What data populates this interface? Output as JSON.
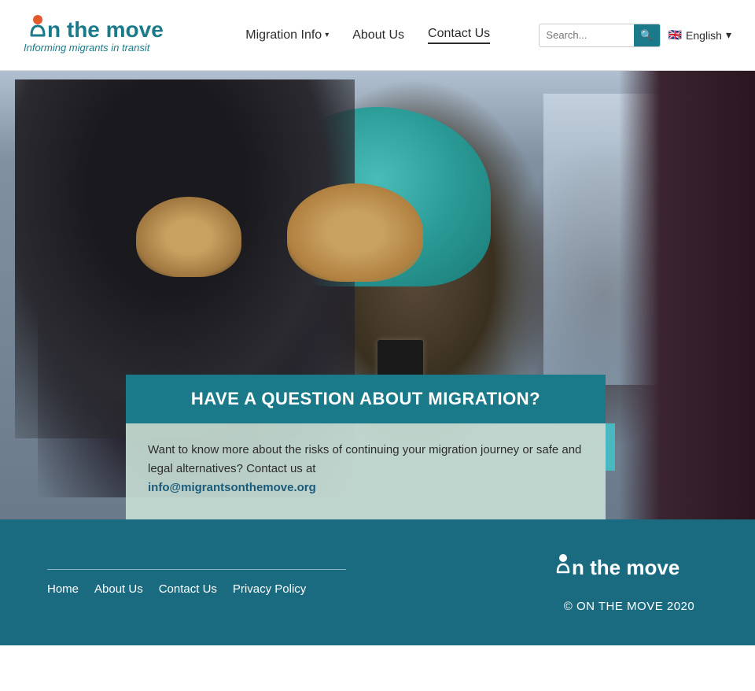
{
  "header": {
    "logo_line1": "ön the move",
    "logo_tagline": "Informing migrants in transit",
    "nav": {
      "migration_info": "Migration Info",
      "about_us": "About Us",
      "contact_us": "Contact Us"
    },
    "search_placeholder": "Search...",
    "lang": "English"
  },
  "hero": {
    "card_title": "HAVE A QUESTION ABOUT MIGRATION?",
    "card_body": "Want to know more about the risks of continuing your migration journey or safe and legal alternatives? Contact us at",
    "card_email": "info@migrantsonthemove.org"
  },
  "footer": {
    "links": [
      "Home",
      "About Us",
      "Contact Us",
      "Privacy Policy"
    ],
    "logo_text": "ön the move",
    "copyright": "© ON THE MOVE 2020"
  }
}
